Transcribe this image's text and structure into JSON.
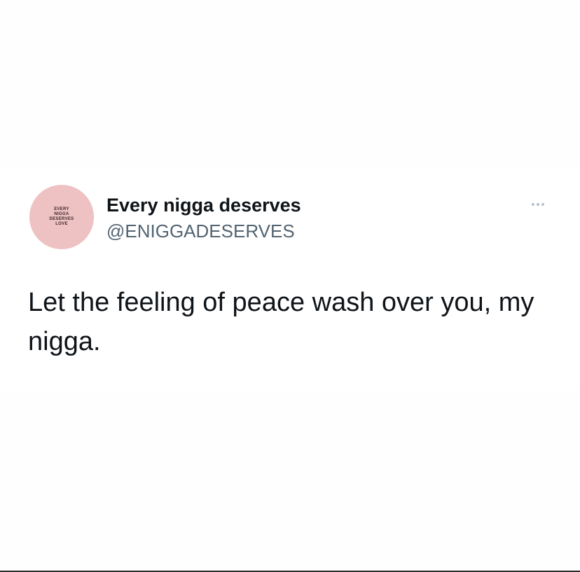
{
  "tweet": {
    "display_name": "Every nigga deserves",
    "handle": "@ENIGGADESERVES",
    "text": "Let the feeling of peace wash over you, my nigga.",
    "avatar": {
      "lines": [
        "EVERY",
        "NIGGA",
        "DESERVES",
        "LOVE"
      ],
      "color": "#eec1c3"
    },
    "more_icon": "more-horizontal-icon"
  },
  "colors": {
    "name": "#0f1419",
    "handle": "#536471",
    "text": "#0f1419"
  }
}
